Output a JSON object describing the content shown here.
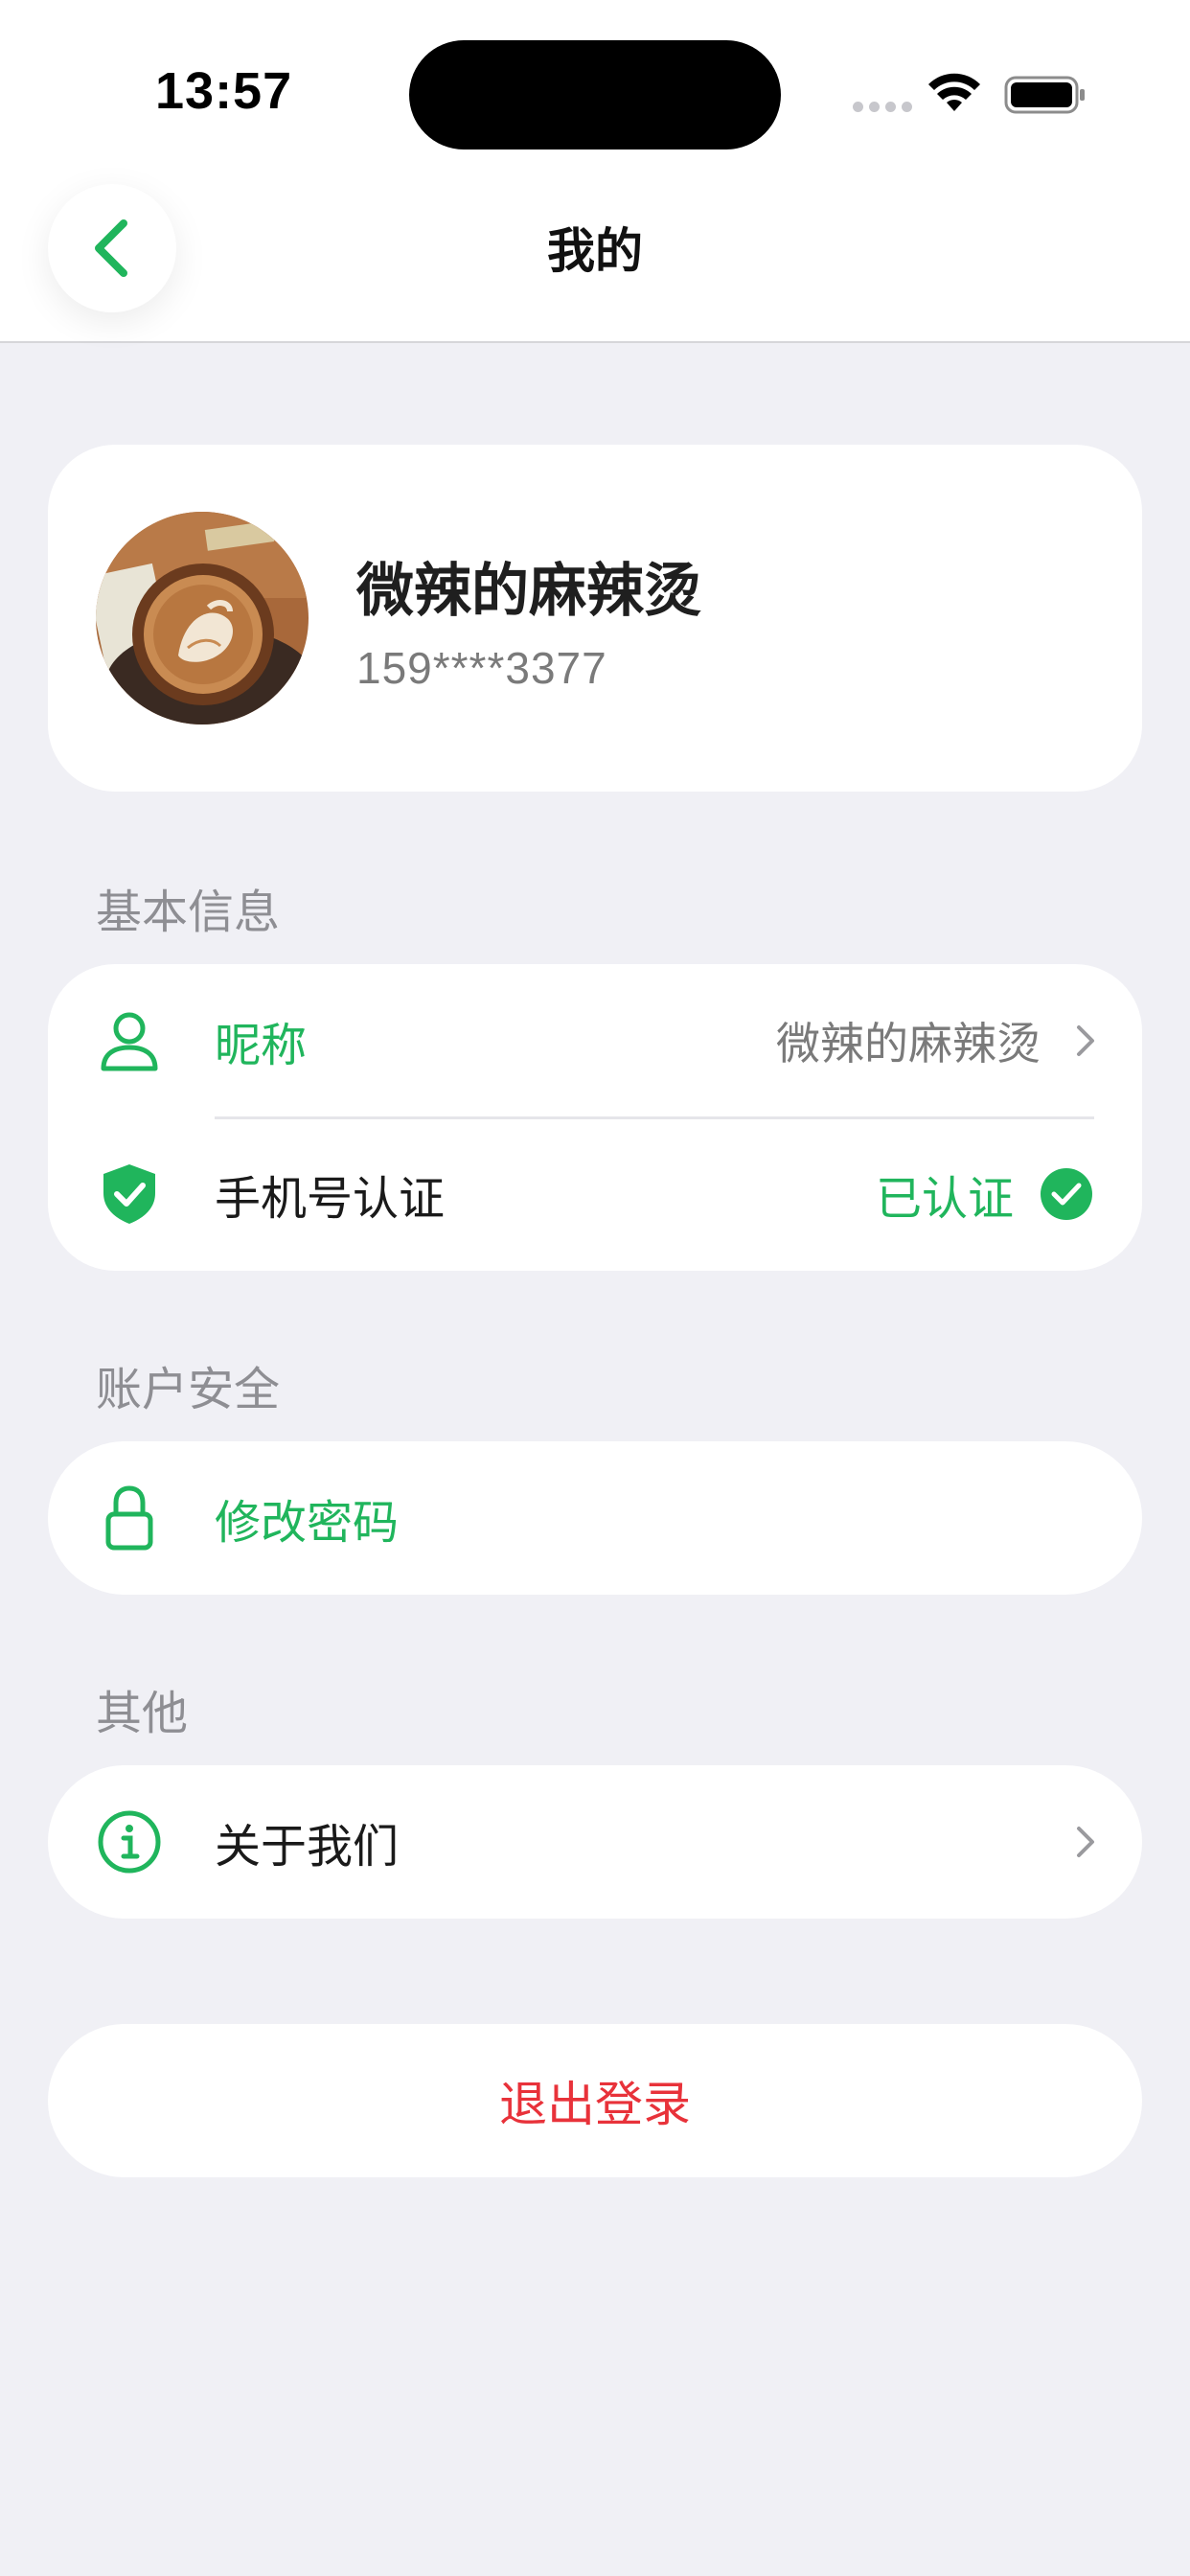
{
  "status_bar": {
    "time": "13:57"
  },
  "header": {
    "title": "我的",
    "back_icon": "chevron-left-icon"
  },
  "profile": {
    "name": "微辣的麻辣烫",
    "phone": "159****3377",
    "avatar": "latte-art-coffee-photo"
  },
  "sections": {
    "basic": {
      "title": "基本信息",
      "nickname": {
        "label": "昵称",
        "value": "微辣的麻辣烫",
        "icon": "person-icon"
      },
      "phone_verify": {
        "label": "手机号认证",
        "status": "已认证",
        "icon": "shield-check-icon"
      }
    },
    "security": {
      "title": "账户安全",
      "change_password": {
        "label": "修改密码",
        "icon": "lock-icon"
      }
    },
    "other": {
      "title": "其他",
      "about": {
        "label": "关于我们",
        "icon": "info-icon"
      }
    }
  },
  "logout": {
    "label": "退出登录"
  },
  "colors": {
    "accent": "#20b55c",
    "danger": "#e8323a",
    "background": "#f0f0f5"
  }
}
